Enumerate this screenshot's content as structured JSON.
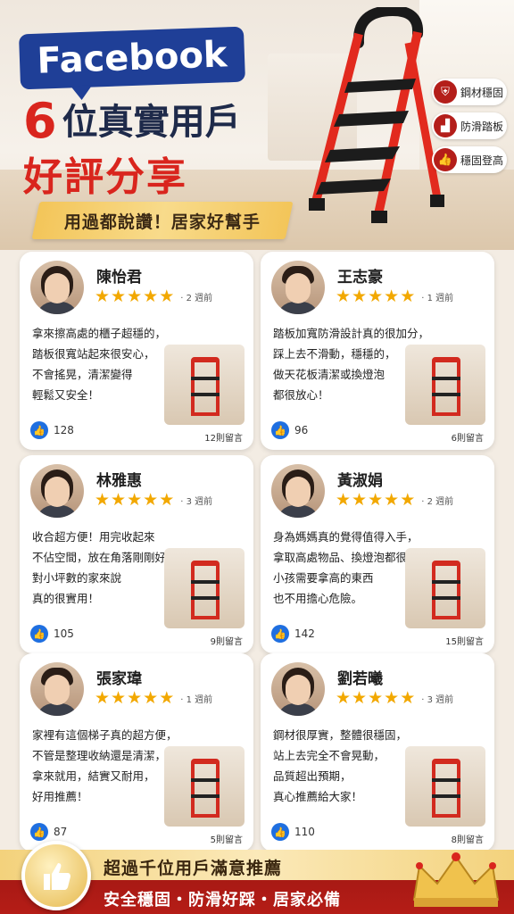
{
  "header": {
    "brand": "Facebook",
    "title_num": "6",
    "title_rest": "位真實用戶",
    "title_line2": "好評分享",
    "ribbon": "用過都說讚！居家好幫手"
  },
  "features": [
    {
      "label": "鋼材穩固",
      "icon": "shield-icon"
    },
    {
      "label": "防滑踏板",
      "icon": "steps-icon"
    },
    {
      "label": "穩固登高",
      "icon": "thumbs-up-icon"
    }
  ],
  "colors": {
    "brand": "#1f3f97",
    "accent": "#d9251d",
    "gold": "#f3c559",
    "like": "#1f6fe0"
  },
  "reviews": [
    {
      "name": "陳怡君",
      "ago": "· 2 週前",
      "text": "拿來擦高處的櫃子超穩的，\n踏板很寬站起來很安心，\n不會搖晃，清潔變得\n輕鬆又安全！",
      "likes": "128",
      "comments": "12則留言"
    },
    {
      "name": "王志豪",
      "ago": "· 1 週前",
      "text": "踏板加寬防滑設計真的很加分，\n踩上去不滑動，穩穩的，\n做天花板清潔或換燈泡\n都很放心！",
      "likes": "96",
      "comments": "6則留言"
    },
    {
      "name": "林雅惠",
      "ago": "· 3 週前",
      "text": "收合超方便！用完收起來\n不佔空間，放在角落剛剛好，\n對小坪數的家來說\n真的很實用！",
      "likes": "105",
      "comments": "9則留言"
    },
    {
      "name": "黃淑娟",
      "ago": "· 2 週前",
      "text": "身為媽媽真的覺得值得入手，\n拿取高處物品、換燈泡都很安心，\n小孩需要拿高的東西\n也不用擔心危險。",
      "likes": "142",
      "comments": "15則留言"
    },
    {
      "name": "張家瑋",
      "ago": "· 1 週前",
      "text": "家裡有這個梯子真的超方便，\n不管是整理收納還是清潔，\n拿來就用，結實又耐用，\n好用推薦！",
      "likes": "87",
      "comments": "5則留言"
    },
    {
      "name": "劉若曦",
      "ago": "· 3 週前",
      "text": "鋼材很厚實，整體很穩固，\n站上去完全不會晃動，\n品質超出預期，\n真心推薦給大家！",
      "likes": "110",
      "comments": "8則留言"
    }
  ],
  "footer": {
    "line1": "超過千位用戶滿意推薦",
    "line2": "安全穩固・防滑好踩・居家必備"
  }
}
